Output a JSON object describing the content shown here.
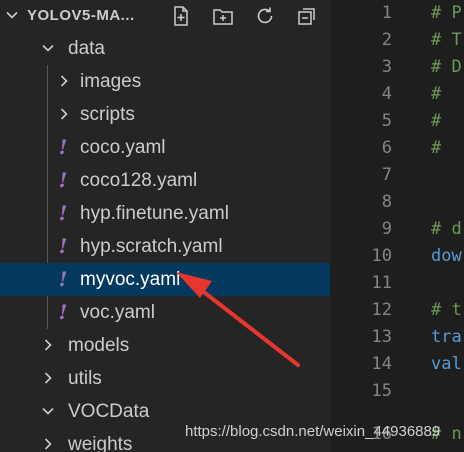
{
  "explorer": {
    "title": "YOLOV5-MA...",
    "actions": [
      "new-file-icon",
      "new-folder-icon",
      "refresh-icon",
      "collapse-all-icon"
    ],
    "items": [
      {
        "label": "data",
        "type": "folder",
        "expanded": true
      },
      {
        "label": "images",
        "type": "folder",
        "expanded": false
      },
      {
        "label": "scripts",
        "type": "folder",
        "expanded": false
      },
      {
        "label": "coco.yaml",
        "type": "yaml"
      },
      {
        "label": "coco128.yaml",
        "type": "yaml"
      },
      {
        "label": "hyp.finetune.yaml",
        "type": "yaml"
      },
      {
        "label": "hyp.scratch.yaml",
        "type": "yaml"
      },
      {
        "label": "myvoc.yaml",
        "type": "yaml",
        "selected": true
      },
      {
        "label": "voc.yaml",
        "type": "yaml"
      },
      {
        "label": "models",
        "type": "folder",
        "expanded": false
      },
      {
        "label": "utils",
        "type": "folder",
        "expanded": false
      },
      {
        "label": "VOCData",
        "type": "folder",
        "expanded": true
      },
      {
        "label": "weights",
        "type": "folder",
        "expanded": false
      }
    ],
    "yaml_glyph": "!"
  },
  "editor": {
    "lines": [
      {
        "n": "1",
        "text": "# P",
        "kind": "comment"
      },
      {
        "n": "2",
        "text": "# T",
        "kind": "comment"
      },
      {
        "n": "3",
        "text": "# D",
        "kind": "comment"
      },
      {
        "n": "4",
        "text": "#",
        "kind": "comment"
      },
      {
        "n": "5",
        "text": "#",
        "kind": "comment"
      },
      {
        "n": "6",
        "text": "#",
        "kind": "comment"
      },
      {
        "n": "7",
        "text": "",
        "kind": "plain"
      },
      {
        "n": "8",
        "text": "",
        "kind": "plain"
      },
      {
        "n": "9",
        "text": "# d",
        "kind": "comment"
      },
      {
        "n": "10",
        "text": "dow",
        "kind": "key"
      },
      {
        "n": "11",
        "text": "",
        "kind": "plain"
      },
      {
        "n": "12",
        "text": "# t",
        "kind": "comment"
      },
      {
        "n": "13",
        "text": "tra",
        "kind": "key"
      },
      {
        "n": "14",
        "text": "val",
        "kind": "key"
      },
      {
        "n": "15",
        "text": "",
        "kind": "plain"
      },
      {
        "n": "16",
        "text": "# n",
        "kind": "comment"
      }
    ]
  },
  "watermark": "https://blog.csdn.net/weixin_44936889",
  "colors": {
    "sidebar_bg": "#252526",
    "editor_bg": "#1e1e1e",
    "selection_bg": "#04395e",
    "yaml_icon": "#a074c4",
    "comment": "#6a9955",
    "key": "#569cd6",
    "arrow": "#e8352f"
  }
}
